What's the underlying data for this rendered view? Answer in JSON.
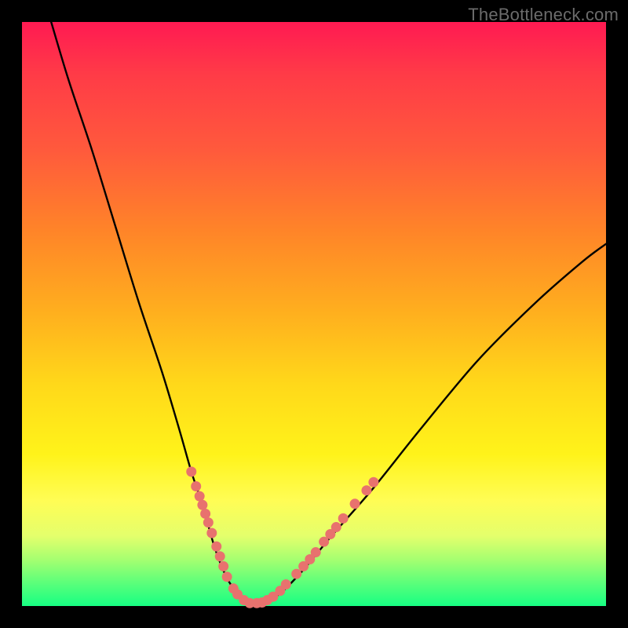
{
  "watermark": "TheBottleneck.com",
  "colors": {
    "background": "#000000",
    "gradient_top": "#ff1a52",
    "gradient_bottom": "#17ff83",
    "curve": "#000000",
    "points": "#e8726e"
  },
  "chart_data": {
    "type": "line",
    "title": "",
    "xlabel": "",
    "ylabel": "",
    "xlim": [
      0,
      100
    ],
    "ylim": [
      0,
      100
    ],
    "grid": false,
    "annotations": [
      "TheBottleneck.com"
    ],
    "series": [
      {
        "name": "bottleneck-curve",
        "x": [
          5,
          8,
          12,
          16,
          20,
          24,
          27,
          29,
          31,
          33,
          35,
          37,
          39,
          41,
          44,
          48,
          53,
          60,
          68,
          78,
          88,
          96,
          100
        ],
        "y": [
          100,
          90,
          78,
          65,
          52,
          40,
          30,
          23,
          17,
          10,
          5,
          2,
          0.5,
          0.5,
          2,
          6,
          12,
          20,
          30,
          42,
          52,
          59,
          62
        ]
      }
    ],
    "points": [
      {
        "x": 29.0,
        "y": 23.0
      },
      {
        "x": 29.8,
        "y": 20.5
      },
      {
        "x": 30.4,
        "y": 18.8
      },
      {
        "x": 30.9,
        "y": 17.3
      },
      {
        "x": 31.4,
        "y": 15.8
      },
      {
        "x": 31.9,
        "y": 14.3
      },
      {
        "x": 32.5,
        "y": 12.5
      },
      {
        "x": 33.3,
        "y": 10.2
      },
      {
        "x": 33.9,
        "y": 8.5
      },
      {
        "x": 34.5,
        "y": 6.8
      },
      {
        "x": 35.1,
        "y": 5.0
      },
      {
        "x": 36.2,
        "y": 3.0
      },
      {
        "x": 36.9,
        "y": 2.0
      },
      {
        "x": 38.0,
        "y": 1.0
      },
      {
        "x": 39.0,
        "y": 0.5
      },
      {
        "x": 40.2,
        "y": 0.5
      },
      {
        "x": 41.1,
        "y": 0.6
      },
      {
        "x": 42.0,
        "y": 1.0
      },
      {
        "x": 43.0,
        "y": 1.6
      },
      {
        "x": 44.2,
        "y": 2.6
      },
      {
        "x": 45.2,
        "y": 3.7
      },
      {
        "x": 47.0,
        "y": 5.5
      },
      {
        "x": 48.2,
        "y": 6.8
      },
      {
        "x": 49.3,
        "y": 8.0
      },
      {
        "x": 50.3,
        "y": 9.2
      },
      {
        "x": 51.7,
        "y": 11.0
      },
      {
        "x": 52.8,
        "y": 12.3
      },
      {
        "x": 53.8,
        "y": 13.5
      },
      {
        "x": 55.0,
        "y": 15.0
      },
      {
        "x": 57.0,
        "y": 17.5
      },
      {
        "x": 59.0,
        "y": 19.8
      },
      {
        "x": 60.2,
        "y": 21.2
      }
    ]
  }
}
